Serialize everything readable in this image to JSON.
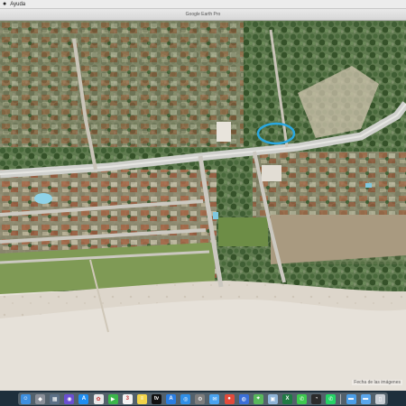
{
  "menubar": {
    "apple_icon": "apple-icon",
    "items": [
      "Ayuda"
    ]
  },
  "window": {
    "title": "Google Earth Pro"
  },
  "map": {
    "attribution": "Fecha de las imágenes",
    "highlight_color": "#2aa7e0"
  },
  "dock": {
    "apps": [
      {
        "name": "finder-icon",
        "glyph": "☺",
        "color": "#3d8fe0"
      },
      {
        "name": "launchpad-icon",
        "glyph": "◆",
        "color": "#8a8f98"
      },
      {
        "name": "mission-control-icon",
        "glyph": "▦",
        "color": "#5b6f86"
      },
      {
        "name": "siri-icon",
        "glyph": "◉",
        "color": "#6a4fd1"
      },
      {
        "name": "app-store-icon",
        "glyph": "A",
        "color": "#1f8ef1"
      },
      {
        "name": "photos-icon",
        "glyph": "✿",
        "color": "#e8e8e8"
      },
      {
        "name": "facetime-icon",
        "glyph": "▶",
        "color": "#3bb54a"
      },
      {
        "name": "calendar-icon",
        "glyph": "3",
        "color": "#f2f2f2"
      },
      {
        "name": "notes-icon",
        "glyph": "≡",
        "color": "#f2d44b"
      },
      {
        "name": "apple-tv-icon",
        "glyph": "tv",
        "color": "#111111"
      },
      {
        "name": "app-store-2-icon",
        "glyph": "A",
        "color": "#2a7de1"
      },
      {
        "name": "safari-icon",
        "glyph": "◎",
        "color": "#2f8fe8"
      },
      {
        "name": "system-preferences-icon",
        "glyph": "⚙",
        "color": "#7d7d7d"
      },
      {
        "name": "mail-icon",
        "glyph": "✉",
        "color": "#4aa3f0"
      },
      {
        "name": "chrome-icon",
        "glyph": "●",
        "color": "#e24b3b"
      },
      {
        "name": "google-earth-icon",
        "glyph": "◍",
        "color": "#3a6fd8"
      },
      {
        "name": "maps-icon",
        "glyph": "⌖",
        "color": "#58b85c"
      },
      {
        "name": "preview-icon",
        "glyph": "▣",
        "color": "#8fb4d8"
      },
      {
        "name": "excel-icon",
        "glyph": "X",
        "color": "#1f7a43"
      },
      {
        "name": "messages-icon",
        "glyph": "✆",
        "color": "#3ec84f"
      },
      {
        "name": "activity-monitor-icon",
        "glyph": "◔",
        "color": "#2b2b2b"
      },
      {
        "name": "whatsapp-icon",
        "glyph": "✆",
        "color": "#25d366"
      }
    ],
    "right_items": [
      {
        "name": "folder-icon",
        "glyph": "▬",
        "color": "#4b9ee8"
      },
      {
        "name": "downloads-icon",
        "glyph": "▬",
        "color": "#5aa6ec"
      },
      {
        "name": "trash-icon",
        "glyph": "▯",
        "color": "#c9ced4"
      }
    ]
  }
}
